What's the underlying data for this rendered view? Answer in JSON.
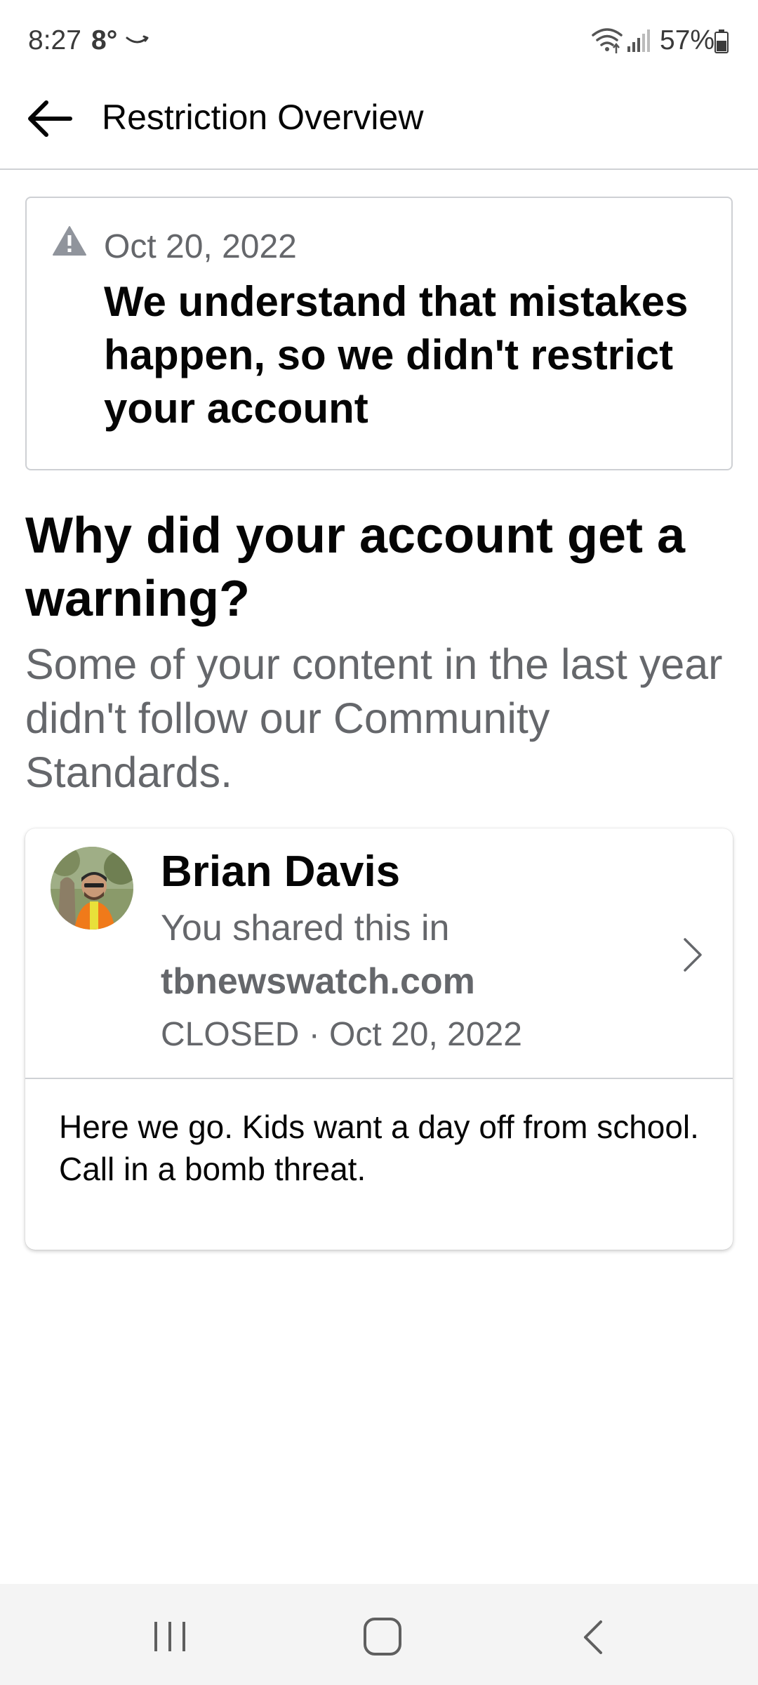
{
  "status_bar": {
    "time": "8:27",
    "temperature": "8°",
    "battery_percent": "57%",
    "icons": [
      "amazon-icon",
      "wifi-icon",
      "signal-icon",
      "battery-icon"
    ]
  },
  "app_bar": {
    "title": "Restriction Overview",
    "back_icon": "arrow-left-icon"
  },
  "notice": {
    "icon": "warning-triangle-icon",
    "date": "Oct 20, 2022",
    "message": "We understand that mistakes happen, so we didn't restrict your account"
  },
  "section": {
    "heading": "Why did your account get a warning?",
    "subtext": "Some of your content in the last year didn't follow our Community Standards."
  },
  "content_card": {
    "author": "Brian Davis",
    "shared_in_label": "You shared this in",
    "site": "tbnewswatch.com",
    "status_line": "CLOSED · Oct 20, 2022",
    "post_text": "Here we go. Kids want a day off from school. Call in a bomb threat.",
    "chevron_icon": "chevron-right-icon"
  },
  "nav_bar": {
    "icons": [
      "recents-icon",
      "home-icon",
      "back-icon"
    ]
  },
  "colors": {
    "primary_text": "#050505",
    "secondary_text": "#65676b",
    "border": "#ced0d4",
    "nav_background": "#f4f4f4"
  }
}
